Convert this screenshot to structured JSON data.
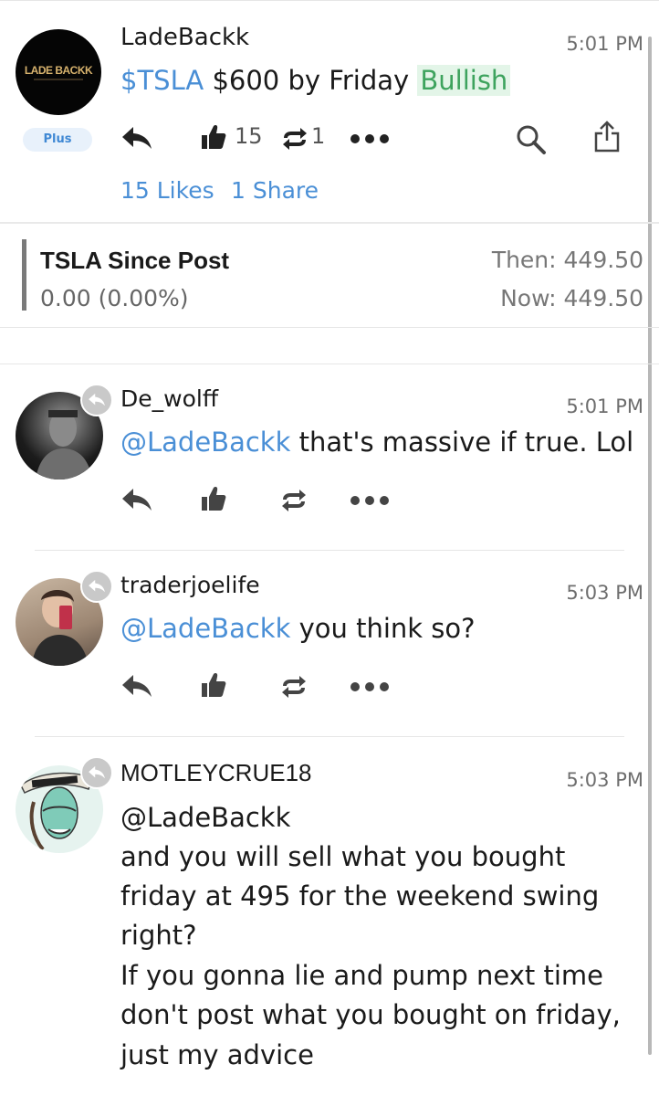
{
  "post": {
    "username": "LadeBackk",
    "logo_text": "LADE BACKK",
    "badge": "Plus",
    "time": "5:01 PM",
    "ticker": "$TSLA",
    "text": " $600 by Friday ",
    "sentiment": "Bullish",
    "like_count": "15",
    "share_count": "1",
    "likes_link": "15 Likes",
    "shares_link": "1 Share"
  },
  "since_post": {
    "title": "TSLA Since Post",
    "change": "0.00 (0.00%)",
    "then": "Then: 449.50",
    "now": "Now: 449.50"
  },
  "comments": [
    {
      "username": "De_wolff",
      "time": "5:01 PM",
      "mention": "@LadeBackk",
      "text": " that's massive if true. Lol"
    },
    {
      "username": "traderjoelife",
      "time": "5:03 PM",
      "mention": "@LadeBackk",
      "text": " you think so?"
    },
    {
      "username": "MOTLEYCRUE18",
      "time": "5:03 PM",
      "mention": "@LadeBackk",
      "lines": [
        "and you will sell what you bought",
        "friday at 495 for the weekend swing",
        "right?",
        "If you gonna lie and pump next time",
        "don't post what you bought on friday,",
        "just my advice"
      ]
    }
  ],
  "colors": {
    "link": "#4a8fd6",
    "bullish_text": "#3ea35e",
    "bullish_bg": "#e3f5e8",
    "plus_bg": "#e8f1fb"
  },
  "icons": [
    "reply-icon",
    "like-icon",
    "reshare-icon",
    "more-icon",
    "search-icon",
    "share-icon",
    "reply-badge-icon"
  ]
}
